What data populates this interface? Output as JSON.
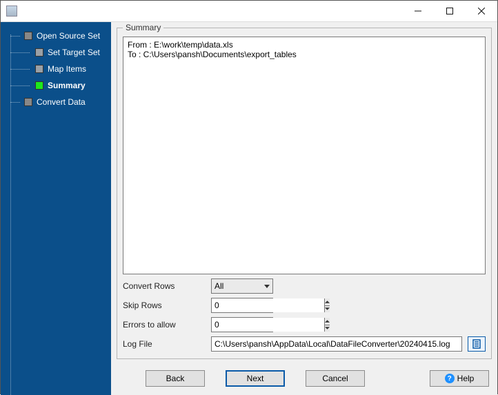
{
  "window": {
    "title": ""
  },
  "sidebar": {
    "items": [
      {
        "label": "Open Source Set",
        "level": "root",
        "active": false
      },
      {
        "label": "Set Target Set",
        "level": "child",
        "active": false
      },
      {
        "label": "Map Items",
        "level": "child",
        "active": false
      },
      {
        "label": "Summary",
        "level": "child",
        "active": true
      },
      {
        "label": "Convert Data",
        "level": "root",
        "active": false
      }
    ]
  },
  "summary_panel": {
    "title": "Summary",
    "lines": [
      "From : E:\\work\\temp\\data.xls",
      "To : C:\\Users\\pansh\\Documents\\export_tables"
    ]
  },
  "options": {
    "convert_rows_label": "Convert Rows",
    "convert_rows_value": "All",
    "skip_rows_label": "Skip Rows",
    "skip_rows_value": "0",
    "errors_label": "Errors to allow",
    "errors_value": "0",
    "log_file_label": "Log File",
    "log_file_value": "C:\\Users\\pansh\\AppData\\Local\\DataFileConverter\\20240415.log"
  },
  "buttons": {
    "back": "Back",
    "next": "Next",
    "cancel": "Cancel",
    "help": "Help"
  }
}
